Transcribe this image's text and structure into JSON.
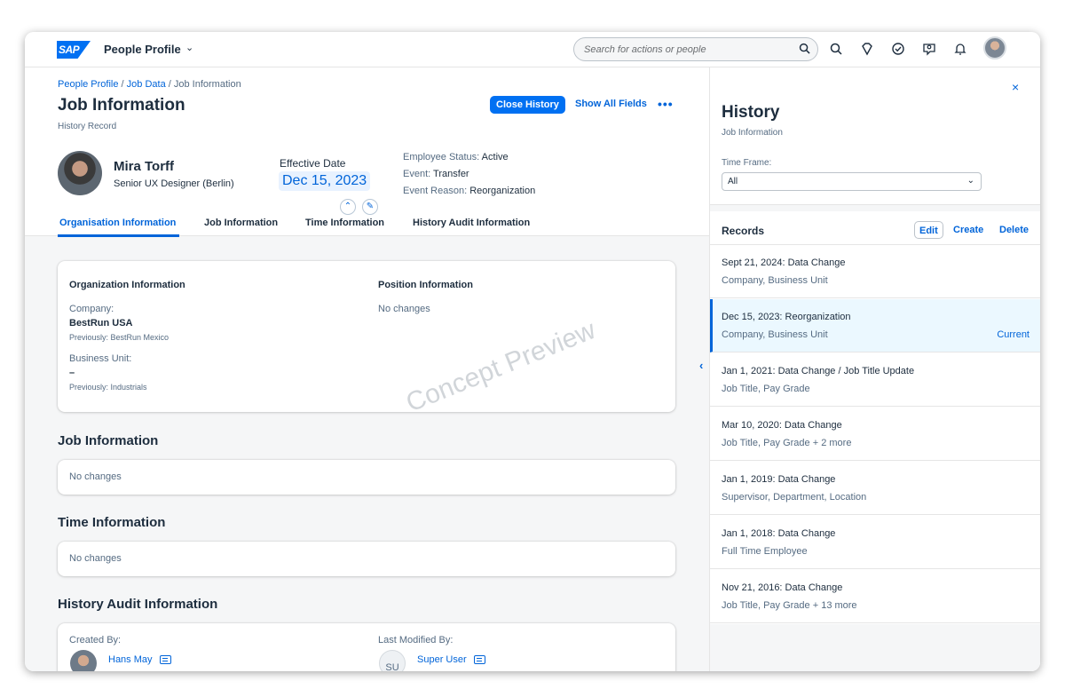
{
  "shell": {
    "logo_text": "SAP",
    "app_title": "People Profile",
    "search_placeholder": "Search for actions or people"
  },
  "header": {
    "breadcrumbs": [
      "People Profile",
      "Job Data",
      "Job Information"
    ],
    "title": "Job Information",
    "subtitle": "History Record",
    "close_history": "Close History",
    "show_all_fields": "Show All Fields",
    "more": "•••",
    "person": {
      "name": "Mira Torff",
      "role": "Senior UX Designer (Berlin)"
    },
    "effective_date_label": "Effective Date",
    "effective_date": "Dec 15, 2023",
    "employee_status_label": "Employee Status:",
    "employee_status": "Active",
    "event_label": "Event:",
    "event": "Transfer",
    "event_reason_label": "Event Reason:",
    "event_reason": "Reorganization"
  },
  "tabs": [
    "Organisation Information",
    "Job Information",
    "Time Information",
    "History Audit Information"
  ],
  "org_card": {
    "org_heading": "Organization Information",
    "position_heading": "Position Information",
    "company_label": "Company:",
    "company_value": "BestRun USA",
    "company_prev": "Previously: BestRun Mexico",
    "bu_label": "Business Unit:",
    "bu_value": "–",
    "bu_prev": "Previously: Industrials",
    "position_value": "No changes"
  },
  "watermark": "Concept Preview",
  "job_section": {
    "title": "Job Information",
    "value": "No changes"
  },
  "time_section": {
    "title": "Time Information",
    "value": "No changes"
  },
  "audit_section": {
    "title": "History Audit Information",
    "created_by_label": "Created By:",
    "created_by": "Hans May",
    "modified_by_label": "Last Modified By:",
    "modified_by": "Super User",
    "modified_initials": "SU"
  },
  "history_panel": {
    "close": "×",
    "title": "History",
    "subtitle": "Job Information",
    "timeframe_label": "Time Frame:",
    "timeframe_value": "All",
    "records_title": "Records",
    "edit": "Edit",
    "create": "Create",
    "delete": "Delete",
    "current": "Current",
    "records": [
      {
        "title": "Sept 21, 2024: Data Change",
        "detail": "Company, Business Unit"
      },
      {
        "title": "Dec 15, 2023: Reorganization",
        "detail": "Company, Business Unit"
      },
      {
        "title": "Jan 1, 2021: Data Change / Job Title Update",
        "detail": "Job Title, Pay Grade"
      },
      {
        "title": "Mar 10, 2020: Data Change",
        "detail": "Job Title, Pay Grade + 2 more"
      },
      {
        "title": "Jan 1, 2019: Data Change",
        "detail": "Supervisor, Department, Location"
      },
      {
        "title": "Jan 1, 2018: Data Change",
        "detail": "Full Time Employee"
      },
      {
        "title": "Nov 21, 2016: Data Change",
        "detail": "Job Title, Pay Grade + 13 more"
      }
    ]
  },
  "colors": {
    "accent": "#0070f2",
    "link": "#0064d9",
    "text": "#1d2d3e",
    "muted": "#556b82",
    "selected_row": "#ebf8ff"
  },
  "icons": [
    "search-icon",
    "magnifier-icon",
    "diamond-icon",
    "check-circle-icon",
    "person-chat-icon",
    "bell-icon",
    "user-avatar",
    "collapse-icon",
    "pin-icon",
    "vcard-icon"
  ]
}
